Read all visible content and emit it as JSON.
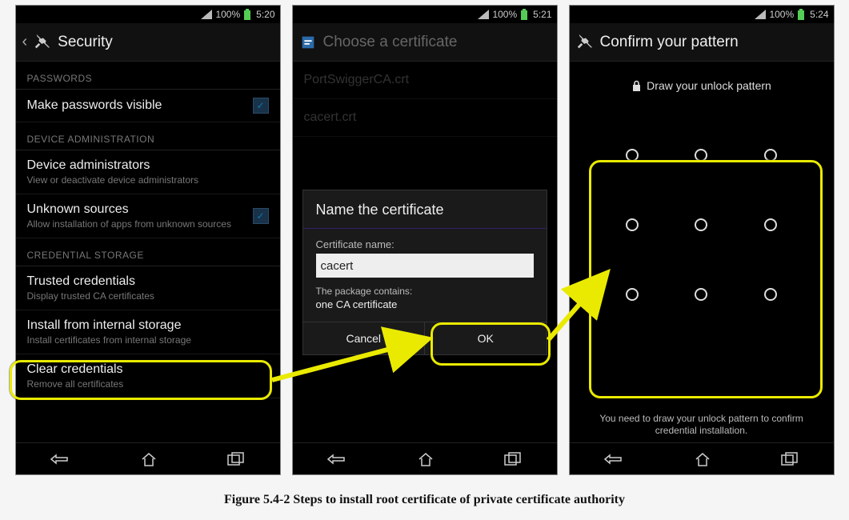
{
  "screen1": {
    "status": {
      "battery": "100%",
      "time": "5:20"
    },
    "title": "Security",
    "sections": {
      "passwords": {
        "header": "PASSWORDS",
        "item_visible": "Make passwords visible"
      },
      "device_admin": {
        "header": "DEVICE ADMINISTRATION",
        "admins_title": "Device administrators",
        "admins_sub": "View or deactivate device administrators",
        "unknown_title": "Unknown sources",
        "unknown_sub": "Allow installation of apps from unknown sources"
      },
      "cred": {
        "header": "CREDENTIAL STORAGE",
        "trusted_title": "Trusted credentials",
        "trusted_sub": "Display trusted CA certificates",
        "install_title": "Install from internal storage",
        "install_sub": "Install certificates from internal storage",
        "clear_title": "Clear credentials",
        "clear_sub": "Remove all certificates"
      }
    }
  },
  "screen2": {
    "status": {
      "battery": "100%",
      "time": "5:21"
    },
    "title": "Choose a certificate",
    "list_item1": "PortSwiggerCA.crt",
    "list_item2": "cacert.crt",
    "dialog": {
      "title": "Name the certificate",
      "field_label": "Certificate name:",
      "input_value": "cacert",
      "pkg_label": "The package contains:",
      "pkg_detail": "one CA certificate",
      "cancel": "Cancel",
      "ok": "OK"
    }
  },
  "screen3": {
    "status": {
      "battery": "100%",
      "time": "5:24"
    },
    "title": "Confirm your pattern",
    "draw_label": "Draw your unlock pattern",
    "note": "You need to draw your unlock pattern to confirm credential installation."
  },
  "caption": "Figure 5.4-2 Steps to install root certificate of private certificate authority"
}
